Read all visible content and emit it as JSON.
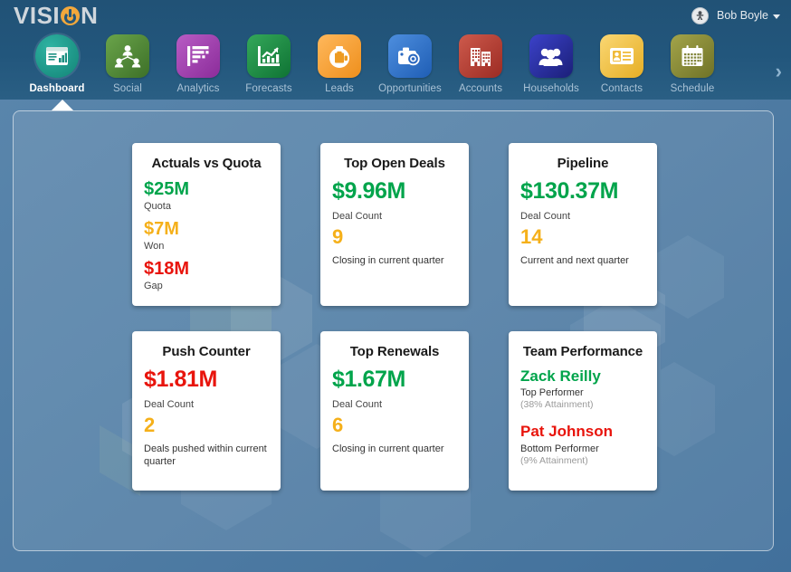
{
  "header": {
    "logo_text_1": "VISI",
    "logo_o": "power-icon",
    "logo_text_2": "N",
    "user_name": "Bob Boyle",
    "avatar_icon": "user-avatar-icon",
    "caret_icon": "caret-down-icon",
    "next_arrow": "›"
  },
  "nav": {
    "items": [
      {
        "label": "Dashboard",
        "icon": "dashboard-icon",
        "color": "#17998a",
        "active": true
      },
      {
        "label": "Social",
        "icon": "social-icon",
        "color": "#4e8a35",
        "active": false
      },
      {
        "label": "Analytics",
        "icon": "analytics-icon",
        "color": "#9b3fa8",
        "active": false
      },
      {
        "label": "Forecasts",
        "icon": "forecasts-icon",
        "color": "#1d8c41",
        "active": false
      },
      {
        "label": "Leads",
        "icon": "leads-icon",
        "color": "#f5a033",
        "active": false
      },
      {
        "label": "Opportunities",
        "icon": "opportunities-icon",
        "color": "#2c6fc4",
        "active": false
      },
      {
        "label": "Accounts",
        "icon": "accounts-icon",
        "color": "#b5392f",
        "active": false
      },
      {
        "label": "Households",
        "icon": "households-icon",
        "color": "#2a2f9e",
        "active": false
      },
      {
        "label": "Contacts",
        "icon": "contacts-icon",
        "color": "#f0c23c",
        "active": false
      },
      {
        "label": "Schedule",
        "icon": "schedule-icon",
        "color": "#8a8a34",
        "active": false
      }
    ]
  },
  "cards": {
    "actuals_vs_quota": {
      "title": "Actuals vs Quota",
      "quota_value": "$25M",
      "quota_label": "Quota",
      "won_value": "$7M",
      "won_label": "Won",
      "gap_value": "$18M",
      "gap_label": "Gap"
    },
    "top_open_deals": {
      "title": "Top Open Deals",
      "amount": "$9.96M",
      "count_label": "Deal Count",
      "count": "9",
      "caption": "Closing in current quarter"
    },
    "pipeline": {
      "title": "Pipeline",
      "amount": "$130.37M",
      "count_label": "Deal Count",
      "count": "14",
      "caption": "Current and next quarter"
    },
    "push_counter": {
      "title": "Push Counter",
      "amount": "$1.81M",
      "count_label": "Deal Count",
      "count": "2",
      "caption": "Deals pushed within current quarter"
    },
    "top_renewals": {
      "title": "Top Renewals",
      "amount": "$1.67M",
      "count_label": "Deal Count",
      "count": "6",
      "caption": "Closing in current quarter"
    },
    "team_performance": {
      "title": "Team Performance",
      "top_name": "Zack Reilly",
      "top_role": "Top Performer",
      "top_attainment": "(38% Attainment)",
      "bottom_name": "Pat Johnson",
      "bottom_role": "Bottom Performer",
      "bottom_attainment": "(9% Attainment)"
    }
  },
  "colors": {
    "green": "#00a44b",
    "amber": "#f5b01a",
    "red": "#e8140c",
    "header_blue": "#22567c",
    "page_blue": "#4e7ba3"
  }
}
